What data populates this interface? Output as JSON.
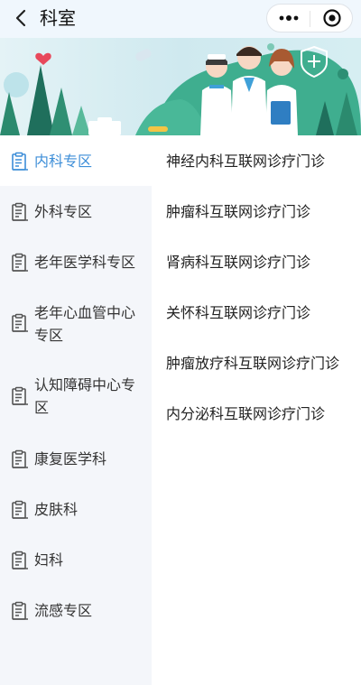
{
  "navbar": {
    "title": "科室"
  },
  "sidebar": {
    "items": [
      {
        "label": "内科专区",
        "active": true
      },
      {
        "label": "外科专区",
        "active": false
      },
      {
        "label": "老年医学科专区",
        "active": false
      },
      {
        "label": "老年心血管中心专区",
        "active": false
      },
      {
        "label": "认知障碍中心专区",
        "active": false
      },
      {
        "label": "康复医学科",
        "active": false
      },
      {
        "label": "皮肤科",
        "active": false
      },
      {
        "label": "妇科",
        "active": false
      },
      {
        "label": "流感专区",
        "active": false
      }
    ]
  },
  "departments": [
    "神经内科互联网诊疗门诊",
    "肿瘤科互联网诊疗门诊",
    "肾病科互联网诊疗门诊",
    "关怀科互联网诊疗门诊",
    "肿瘤放疗科互联网诊疗门诊",
    "内分泌科互联网诊疗门诊"
  ],
  "colors": {
    "accent": "#3d8ed8",
    "navbar_bg": "#f0f7fd",
    "sidebar_bg": "#f4f6fa",
    "banner_bg": "#cfe9ef"
  },
  "icons": {
    "back": "chevron-left-icon",
    "more": "more-dots-icon",
    "close": "target-close-icon",
    "department": "clipboard-icon"
  }
}
